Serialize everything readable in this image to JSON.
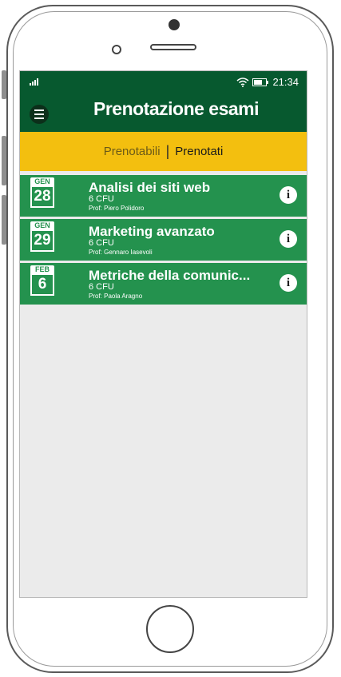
{
  "status": {
    "time": "21:34"
  },
  "header": {
    "title": "Prenotazione esami"
  },
  "tabs": [
    {
      "label": "Prenotabili",
      "active": false
    },
    {
      "label": "Prenotati",
      "active": true
    }
  ],
  "tab_separator": "|",
  "exams": [
    {
      "month": "GEN",
      "day": "28",
      "name": "Analisi dei siti web",
      "credits": "6 CFU",
      "professor": "Prof: Piero Polidoro"
    },
    {
      "month": "GEN",
      "day": "29",
      "name": "Marketing avanzato",
      "credits": "6 CFU",
      "professor": "Prof: Gennaro Iasevoli"
    },
    {
      "month": "FEB",
      "day": "6",
      "name": "Metriche della comunic...",
      "credits": "6 CFU",
      "professor": "Prof: Paola Aragno"
    }
  ],
  "colors": {
    "header": "#07592f",
    "tabs_bar": "#f3bf0f",
    "exam_row": "#24924e",
    "background": "#ebebeb"
  },
  "icons": {
    "menu": "hamburger-menu-icon",
    "info": "info-icon",
    "calendar": "calendar-icon",
    "wifi": "wifi-icon",
    "battery": "battery-icon",
    "signal": "signal-icon"
  }
}
